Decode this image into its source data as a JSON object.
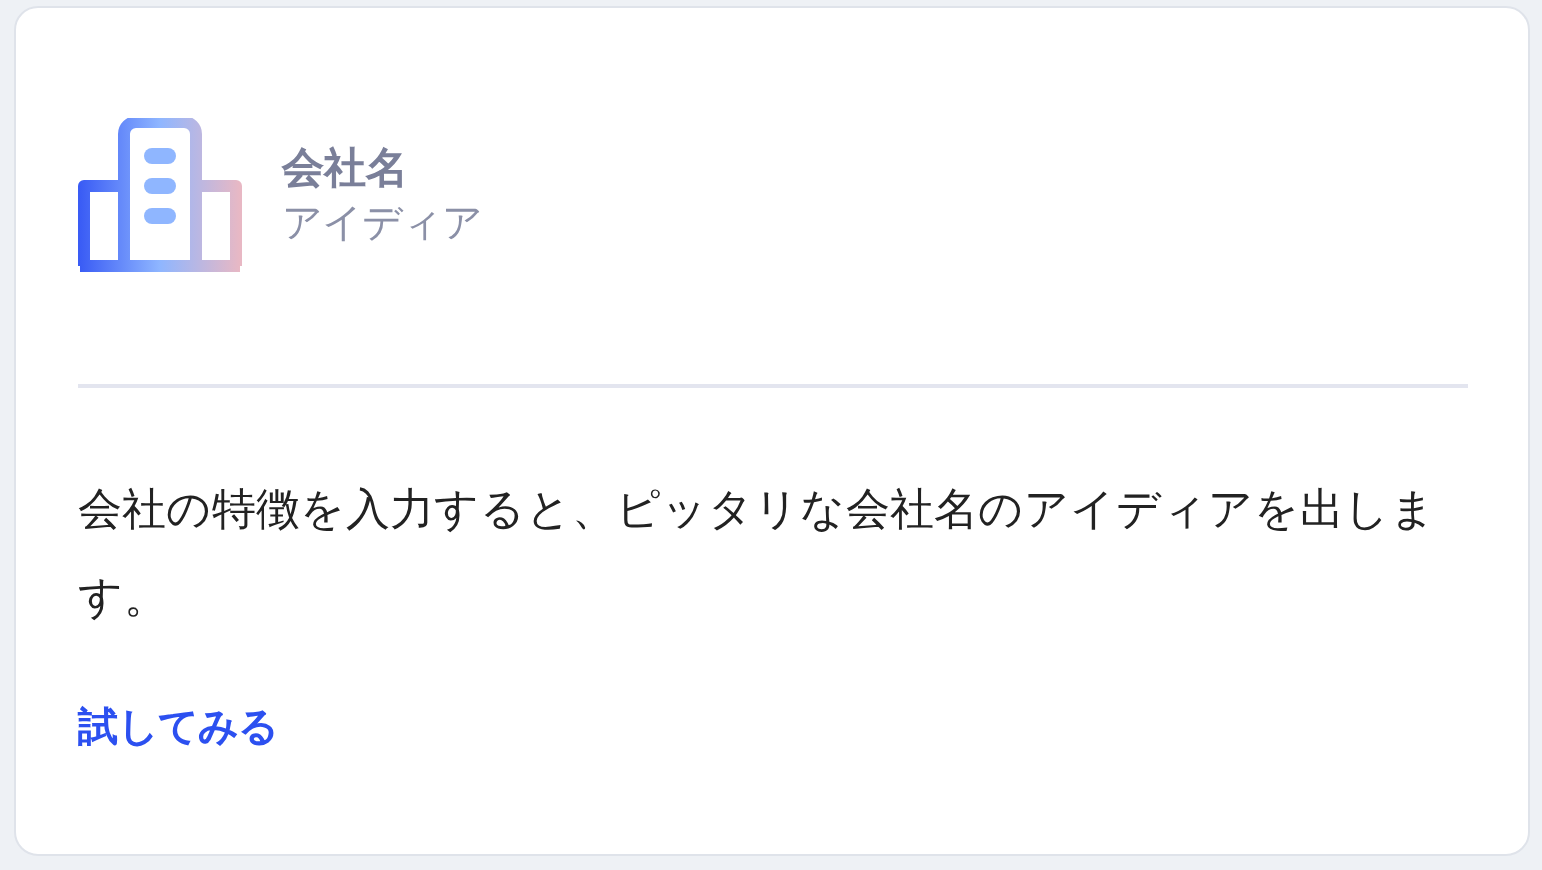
{
  "card": {
    "title": "会社名",
    "subtitle": "アイディア",
    "description": "会社の特徴を入力すると、ピッタリな会社名のアイディアを出します。",
    "link": "試してみる"
  }
}
